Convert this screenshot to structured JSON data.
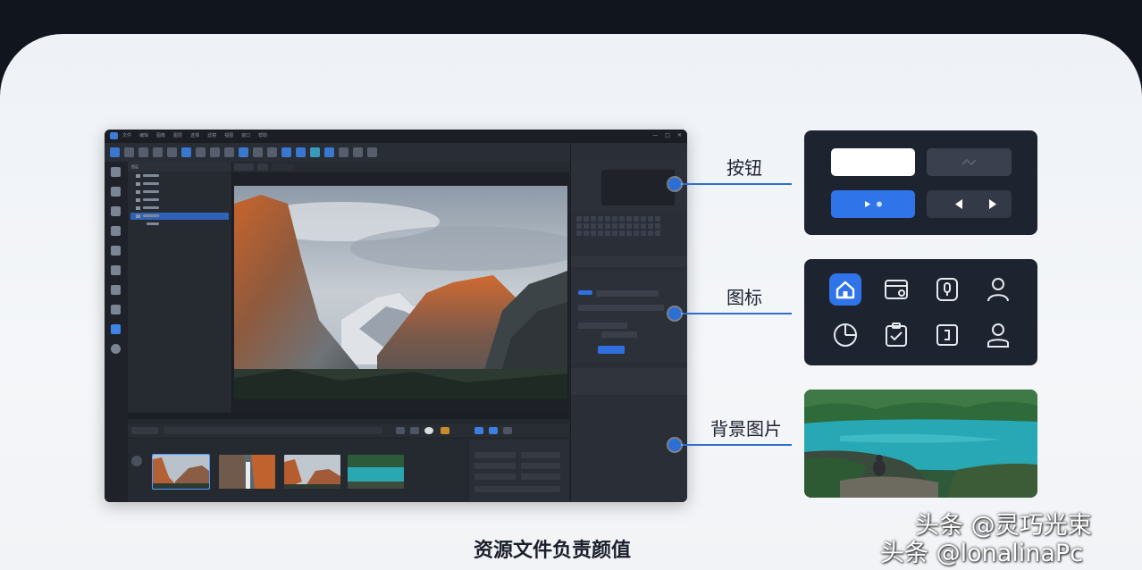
{
  "callouts": {
    "buttons_label": "按钮",
    "icons_label": "图标",
    "background_label": "背景图片"
  },
  "footer_title": "资源文件负责颜值",
  "watermark": {
    "line1": "头条 @灵巧光束",
    "line2": "头条 @lonalinaPc"
  },
  "app": {
    "menu": [
      "文件",
      "编辑",
      "图像",
      "图层",
      "选择",
      "滤镜",
      "视图",
      "窗口",
      "帮助"
    ],
    "window_controls": [
      "—",
      "□",
      "✕"
    ],
    "layers_header": "图层",
    "doc_tab_label": "风景.jpg"
  },
  "icons": [
    "home-icon",
    "wallet-icon",
    "microphone-icon",
    "user-icon",
    "pie-chart-icon",
    "clipboard-check-icon",
    "device-icon",
    "user-icon"
  ],
  "colors": {
    "accent": "#2b6fd6",
    "panel_bg": "#1e2330",
    "primary_button": "#2f6fe0"
  }
}
